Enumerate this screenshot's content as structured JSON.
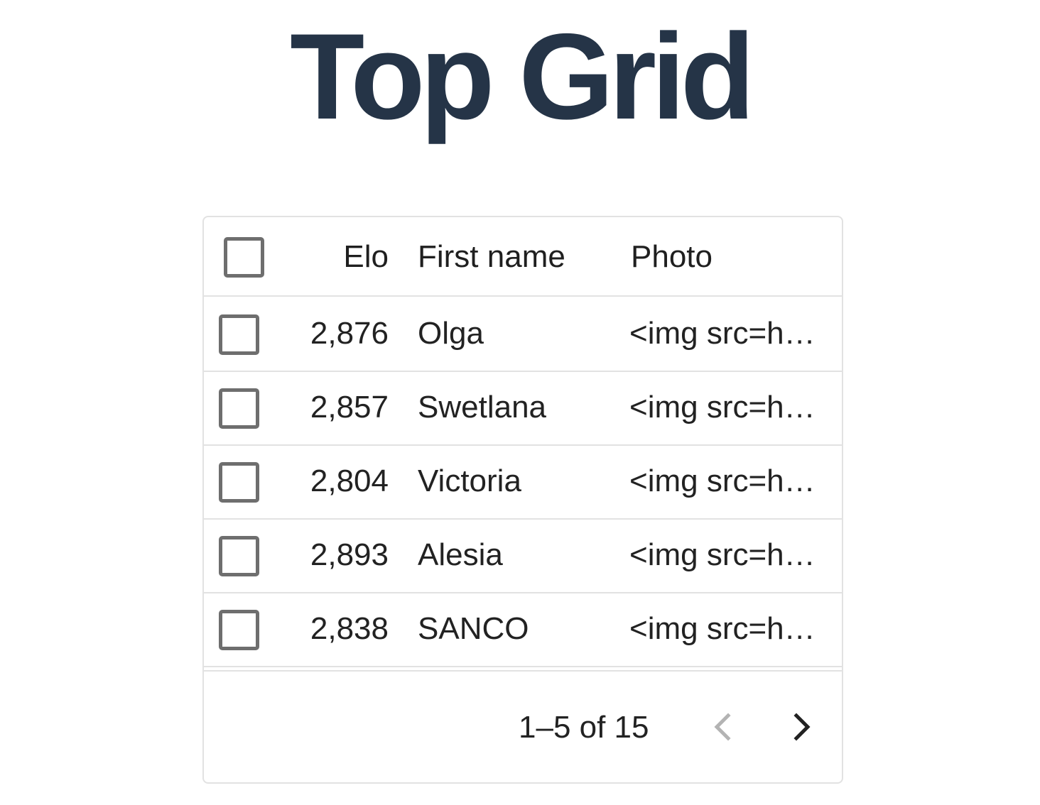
{
  "header": {
    "title": "Top Grid"
  },
  "grid": {
    "columns": {
      "elo": "Elo",
      "first_name": "First name",
      "photo": "Photo"
    },
    "rows": [
      {
        "elo": "2,876",
        "first_name": "Olga",
        "photo": "<img src=h…"
      },
      {
        "elo": "2,857",
        "first_name": "Swetlana",
        "photo": "<img src=h…"
      },
      {
        "elo": "2,804",
        "first_name": "Victoria",
        "photo": "<img src=h…"
      },
      {
        "elo": "2,893",
        "first_name": "Alesia",
        "photo": "<img src=h…"
      },
      {
        "elo": "2,838",
        "first_name": "SANCO",
        "photo": "<img src=h…"
      }
    ]
  },
  "pagination": {
    "range_label": "1–5 of 15",
    "prev_icon": "chevron-left-icon",
    "next_icon": "chevron-right-icon"
  },
  "colors": {
    "title": "#253447",
    "border": "#e2e2e2",
    "checkbox_border": "#6e6e6e",
    "nav_disabled": "#b3b3b3",
    "nav_enabled": "#222222"
  }
}
